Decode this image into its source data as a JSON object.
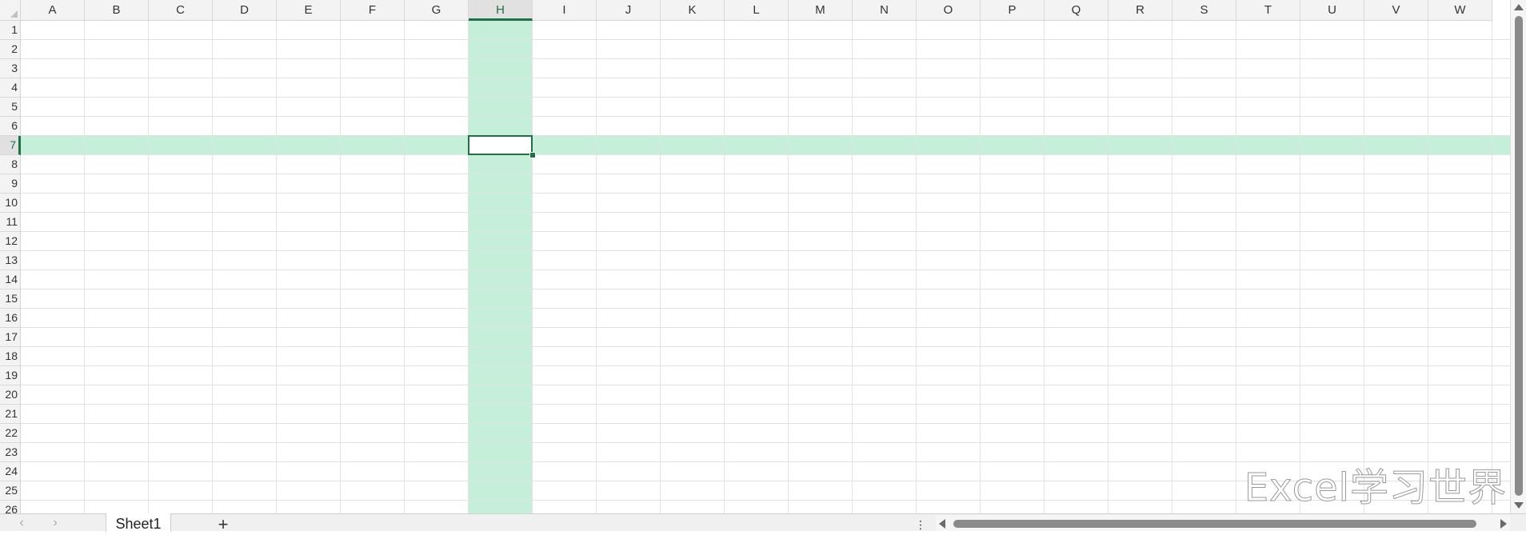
{
  "sheet": {
    "columns": [
      "A",
      "B",
      "C",
      "D",
      "E",
      "F",
      "G",
      "H",
      "I",
      "J",
      "K",
      "L",
      "M",
      "N",
      "O",
      "P",
      "Q",
      "R",
      "S",
      "T",
      "U",
      "V",
      "W"
    ],
    "rows": [
      "1",
      "2",
      "3",
      "4",
      "5",
      "6",
      "7",
      "8",
      "9",
      "10",
      "11",
      "12",
      "13",
      "14",
      "15",
      "16",
      "17",
      "18",
      "19",
      "20",
      "21",
      "22",
      "23",
      "24",
      "25",
      "26"
    ],
    "selected_column": "H",
    "selected_row": "7",
    "highlight_color": "#c6efda",
    "accent_color": "#1e7145"
  },
  "tabs": {
    "sheets": [
      "Sheet1"
    ],
    "add_label": "+",
    "prev_icon": "chevron-left-icon",
    "next_icon": "chevron-right-icon",
    "more_label": "⋮"
  },
  "watermark": {
    "text": "Excel学习世界"
  }
}
